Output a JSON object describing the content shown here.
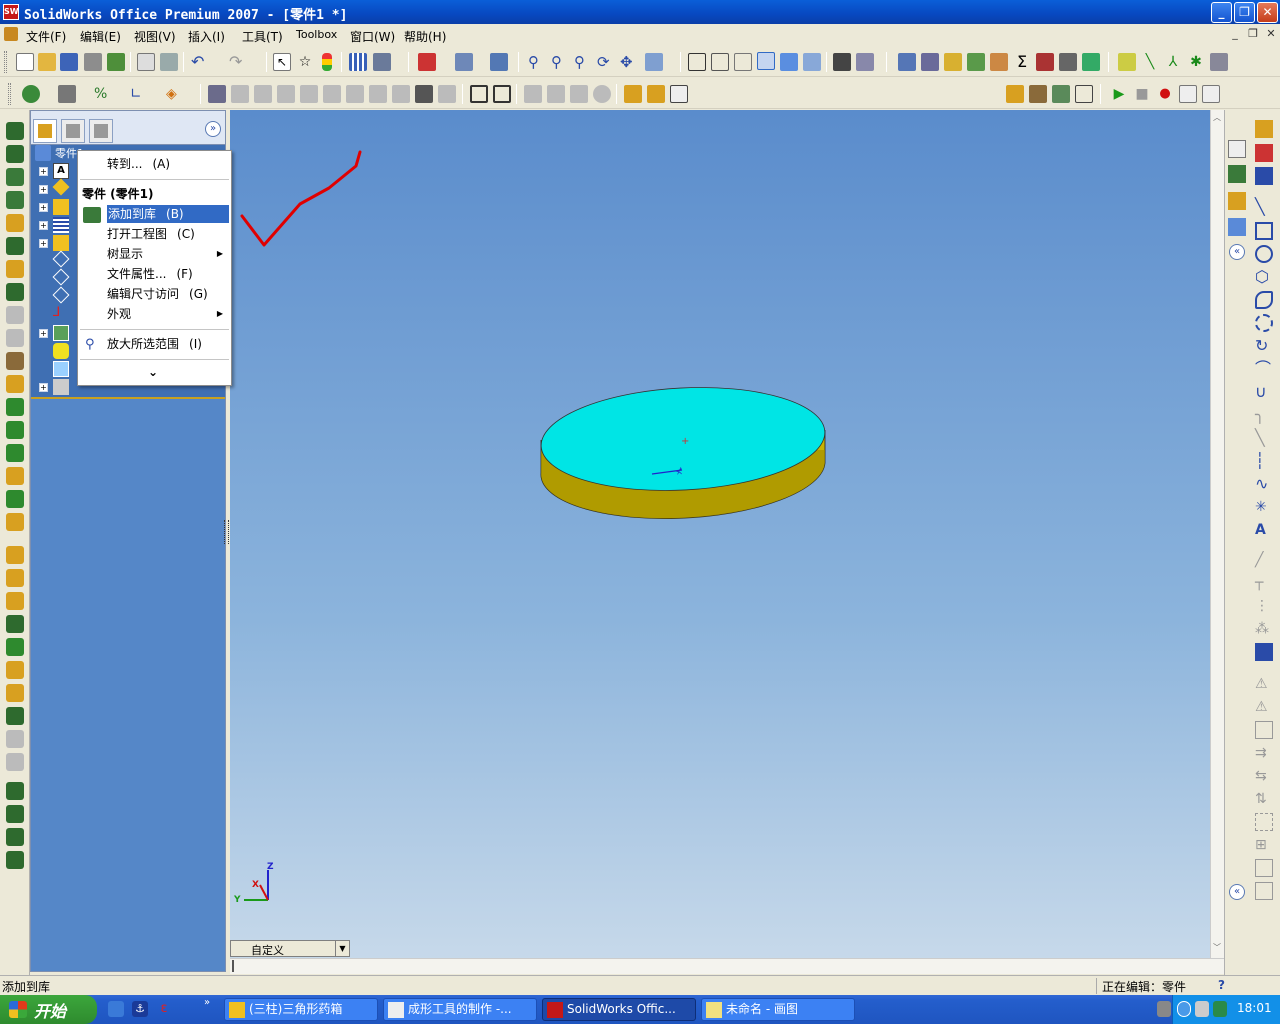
{
  "window": {
    "title": "SolidWorks Office Premium 2007 - [零件1 *]",
    "app_icon": "SW"
  },
  "menubar": {
    "items": [
      "文件(F)",
      "编辑(E)",
      "视图(V)",
      "插入(I)",
      "工具(T)",
      "Toolbox",
      "窗口(W)",
      "帮助(H)"
    ]
  },
  "tree": {
    "root_label": "零件1"
  },
  "context_menu": {
    "goto": {
      "label": "转到...",
      "hotkey": "(A)"
    },
    "section_title": "零件 (零件1)",
    "items": [
      {
        "label": "添加到库",
        "hotkey": "(B)",
        "selected": true
      },
      {
        "label": "打开工程图",
        "hotkey": "(C)"
      },
      {
        "label": "树显示",
        "hotkey": ""
      },
      {
        "label": "文件属性...",
        "hotkey": "(F)"
      },
      {
        "label": "编辑尺寸访问",
        "hotkey": "(G)"
      },
      {
        "label": "外观",
        "hotkey": ""
      }
    ],
    "zoom": {
      "label": "放大所选范围",
      "hotkey": "(I)"
    },
    "expand_glyph": "⌄"
  },
  "viewport": {
    "view_selector": "自定义",
    "axes": {
      "x": "X",
      "y": "Y",
      "z": "Z"
    },
    "colors": {
      "top_face": "#00e5e5",
      "side": "#c8b400",
      "annotation": "#e00000"
    }
  },
  "status": {
    "left": "添加到库",
    "right": "正在编辑：零件",
    "help": "?"
  },
  "taskbar": {
    "start": "开始",
    "buttons": [
      {
        "label": "(三柱)三角形药箱",
        "active": false
      },
      {
        "label": "成形工具的制作 -...",
        "active": false
      },
      {
        "label": "SolidWorks Offic...",
        "active": true
      },
      {
        "label": "未命名 - 画图",
        "active": false
      }
    ],
    "clock": "18:01"
  }
}
